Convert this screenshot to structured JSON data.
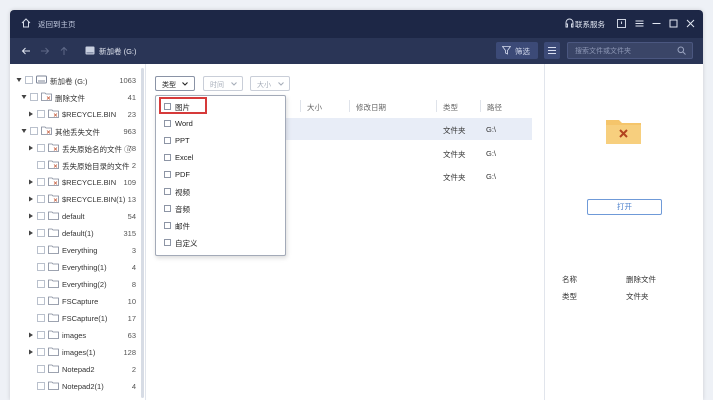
{
  "titlebar": {
    "home_label": "返回到主页",
    "service_label": "联系服务"
  },
  "navbar": {
    "drive_label": "新加卷 (G:)",
    "filter_label": "筛选",
    "search_placeholder": "搜索文件或文件夹"
  },
  "tree": [
    {
      "name": "新加卷 (G:)",
      "count": "1063",
      "level": 0,
      "expanded": true,
      "icon": "drive-icon"
    },
    {
      "name": "删除文件",
      "count": "41",
      "level": 1,
      "expanded": true,
      "icon": "deleted-folder-icon"
    },
    {
      "name": "$RECYCLE.BIN",
      "count": "23",
      "level": 2,
      "expanded": false,
      "icon": "deleted-folder-icon"
    },
    {
      "name": "其他丢失文件",
      "count": "963",
      "level": 1,
      "expanded": true,
      "icon": "deleted-folder-icon"
    },
    {
      "name": "丢失原始名的文件 ⓘ",
      "count": "78",
      "level": 2,
      "expanded": false,
      "icon": "deleted-folder-icon"
    },
    {
      "name": "丢失原始目录的文件",
      "count": "2",
      "level": 2,
      "expanded": null,
      "icon": "deleted-folder-icon"
    },
    {
      "name": "$RECYCLE.BIN",
      "count": "109",
      "level": 2,
      "expanded": false,
      "icon": "deleted-folder-icon"
    },
    {
      "name": "$RECYCLE.BIN(1)",
      "count": "13",
      "level": 2,
      "expanded": false,
      "icon": "deleted-folder-icon"
    },
    {
      "name": "default",
      "count": "54",
      "level": 2,
      "expanded": false,
      "icon": "folder-icon"
    },
    {
      "name": "default(1)",
      "count": "315",
      "level": 2,
      "expanded": false,
      "icon": "folder-icon"
    },
    {
      "name": "Everything",
      "count": "3",
      "level": 2,
      "expanded": null,
      "icon": "folder-icon"
    },
    {
      "name": "Everything(1)",
      "count": "4",
      "level": 2,
      "expanded": null,
      "icon": "folder-icon"
    },
    {
      "name": "Everything(2)",
      "count": "8",
      "level": 2,
      "expanded": null,
      "icon": "folder-icon"
    },
    {
      "name": "FSCapture",
      "count": "10",
      "level": 2,
      "expanded": null,
      "icon": "folder-icon"
    },
    {
      "name": "FSCapture(1)",
      "count": "17",
      "level": 2,
      "expanded": null,
      "icon": "folder-icon"
    },
    {
      "name": "images",
      "count": "63",
      "level": 2,
      "expanded": false,
      "icon": "folder-icon"
    },
    {
      "name": "images(1)",
      "count": "128",
      "level": 2,
      "expanded": false,
      "icon": "folder-icon"
    },
    {
      "name": "Notepad2",
      "count": "2",
      "level": 2,
      "expanded": null,
      "icon": "folder-icon"
    },
    {
      "name": "Notepad2(1)",
      "count": "4",
      "level": 2,
      "expanded": null,
      "icon": "folder-icon"
    }
  ],
  "toolbar": {
    "type_label": "类型",
    "time_label": "时间",
    "size_label": "大小"
  },
  "columns": {
    "size": "大小",
    "modified": "修改日期",
    "type": "类型",
    "path": "路径"
  },
  "rows": [
    {
      "type": "文件夹",
      "path": "G:\\"
    },
    {
      "type": "文件夹",
      "path": "G:\\"
    },
    {
      "type": "文件夹",
      "path": "G:\\"
    }
  ],
  "type_dropdown": [
    "图片",
    "Word",
    "PPT",
    "Excel",
    "PDF",
    "视频",
    "音频",
    "邮件",
    "自定义"
  ],
  "detail": {
    "open_label": "打开",
    "name_key": "名称",
    "name_value": "删除文件",
    "type_key": "类型",
    "type_value": "文件夹"
  },
  "colors": {
    "titlebar": "#1d2746",
    "navbar": "#2a3556",
    "folder": "#f5c56b",
    "focus_outline": "#d63a3a",
    "accent": "#4a7fcc"
  }
}
